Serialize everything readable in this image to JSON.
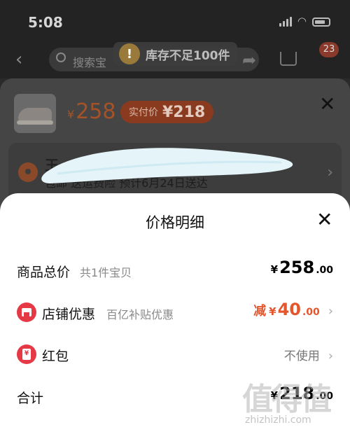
{
  "status_bar": {
    "time": "5:08"
  },
  "header": {
    "search_placeholder": "搜索宝",
    "toast_icon": "!",
    "toast_text": "库存不足100件",
    "cart_badge": "23"
  },
  "sku_sheet": {
    "price_currency": "¥",
    "price": "258",
    "paid_label": "实付价",
    "paid_value": "¥218",
    "address_name": "王",
    "address_line": "包邮  送运费险  预计6月24日送达"
  },
  "price_detail": {
    "title": "价格明细",
    "total_row": {
      "label": "商品总价",
      "sub": "共1件宝贝",
      "currency": "¥",
      "int": "258",
      "dec": ".00"
    },
    "store_row": {
      "label": "店铺优惠",
      "sub": "百亿补贴优惠",
      "prefix": "减",
      "currency": "¥",
      "int": "40",
      "dec": ".00"
    },
    "hongbao_row": {
      "label": "红包",
      "icon_text": "¥",
      "value": "不使用"
    },
    "sum_row": {
      "label": "合计",
      "currency": "¥",
      "int": "218",
      "dec": ".00"
    }
  },
  "watermark": {
    "text": "值得值",
    "url": "zhizhizhi.com"
  },
  "colors": {
    "accent": "#e4572e",
    "store_icon": "#e63946",
    "paid_pill": "#8a3a1e"
  }
}
